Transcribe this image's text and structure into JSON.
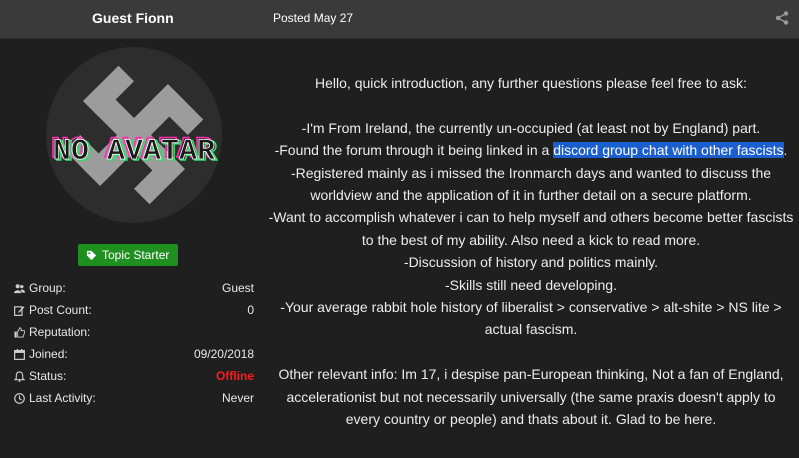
{
  "post": {
    "author": "Guest Fionn",
    "posted": "Posted May 27",
    "share_icon": "share-icon"
  },
  "sidebar": {
    "avatar_text": "NO AVATAR",
    "badge": "Topic Starter",
    "info": [
      {
        "icon": "users-icon",
        "label": "Group:",
        "value": "Guest"
      },
      {
        "icon": "edit-icon",
        "label": "Post Count:",
        "value": "0"
      },
      {
        "icon": "thumbs-up-icon",
        "label": "Reputation:",
        "value": ""
      },
      {
        "icon": "calendar-icon",
        "label": "Joined:",
        "value": "09/20/2018"
      },
      {
        "icon": "bell-icon",
        "label": "Status:",
        "value": "Offline"
      },
      {
        "icon": "clock-icon",
        "label": "Last Activity:",
        "value": "Never"
      }
    ]
  },
  "body": {
    "intro": "Hello, quick introduction, any further questions please feel free to ask:",
    "line1": "-I'm From Ireland, the currently un-occupied (at least not by England) part.",
    "line2_pre": "-Found the forum through it being linked in a ",
    "line2_link": "discord group chat with other fascists",
    "line2_post": ".",
    "line3": "-Registered mainly as i missed the Ironmarch days and wanted to discuss the worldview and the application of it in further detail on a secure platform.",
    "line4": "-Want to accomplish whatever i can to help myself and others become better fascists to the best of my ability. Also need a kick to read more.",
    "line5": "-Discussion of history and politics mainly.",
    "line6": "-Skills still need developing.",
    "line7": "-Your average rabbit hole history of liberalist > conservative > alt-shite > NS lite > actual fascism.",
    "other": "Other relevant info: Im 17, i despise pan-European thinking, Not a fan of England, accelerationist but not necessarily universally (the same praxis doesn't apply to every country or people) and thats about it. Glad to be here."
  },
  "colors": {
    "header_bg": "#3a3a3a",
    "page_bg": "#1f1f1f",
    "badge_bg": "#1f8f1f",
    "offline": "#ff1a1a",
    "highlight": "#1b5fcf"
  }
}
